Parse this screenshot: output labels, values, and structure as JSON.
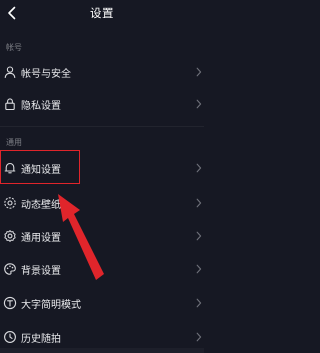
{
  "header": {
    "title": "设置",
    "back_icon": "chevron-left-icon"
  },
  "sections": {
    "account": "帐号",
    "general": "通用"
  },
  "items": [
    {
      "label": "帐号与安全",
      "icon": "person-icon"
    },
    {
      "label": "隐私设置",
      "icon": "lock-icon"
    },
    {
      "label": "通知设置",
      "icon": "bell-icon"
    },
    {
      "label": "动态壁纸",
      "icon": "wallpaper-icon"
    },
    {
      "label": "通用设置",
      "icon": "gear-icon"
    },
    {
      "label": "背景设置",
      "icon": "palette-icon"
    },
    {
      "label": "大字简明模式",
      "icon": "text-size-icon"
    },
    {
      "label": "历史随拍",
      "icon": "history-icon"
    }
  ],
  "colors": {
    "background": "#161823",
    "annotation": "#e0252b",
    "text": "#eaebee",
    "muted": "#7d7f86"
  }
}
